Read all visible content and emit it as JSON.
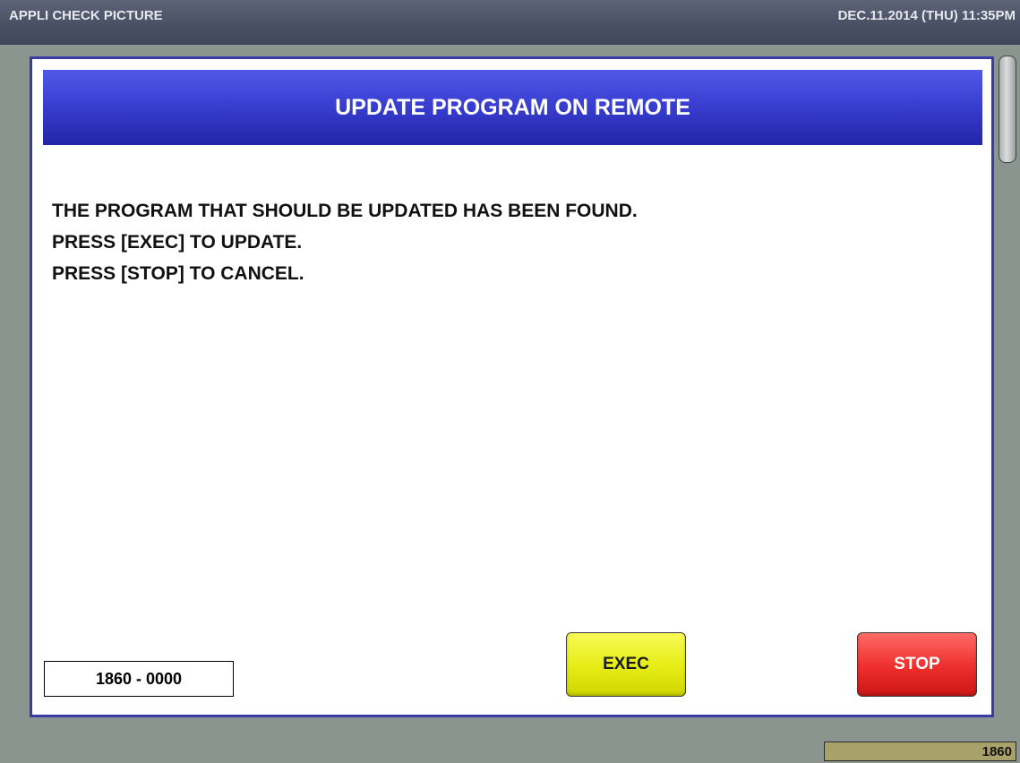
{
  "topbar": {
    "app_title": "APPLI CHECK PICTURE",
    "datetime": "DEC.11.2014 (THU)  11:35PM"
  },
  "dialog": {
    "title": "UPDATE PROGRAM ON REMOTE",
    "message_lines": [
      "THE PROGRAM THAT SHOULD BE UPDATED HAS BEEN FOUND.",
      "PRESS [EXEC] TO UPDATE.",
      "PRESS [STOP] TO CANCEL."
    ],
    "code": "1860 - 0000",
    "exec_label": "EXEC",
    "stop_label": "STOP"
  },
  "status": {
    "value": "1860"
  },
  "colors": {
    "header_blue": "#3a3fd2",
    "exec_yellow": "#e5ec14",
    "stop_red": "#ee2e2c",
    "status_olive": "#a8a26a"
  },
  "icons": {
    "scroll_thumb": "scrollbar-thumb"
  }
}
